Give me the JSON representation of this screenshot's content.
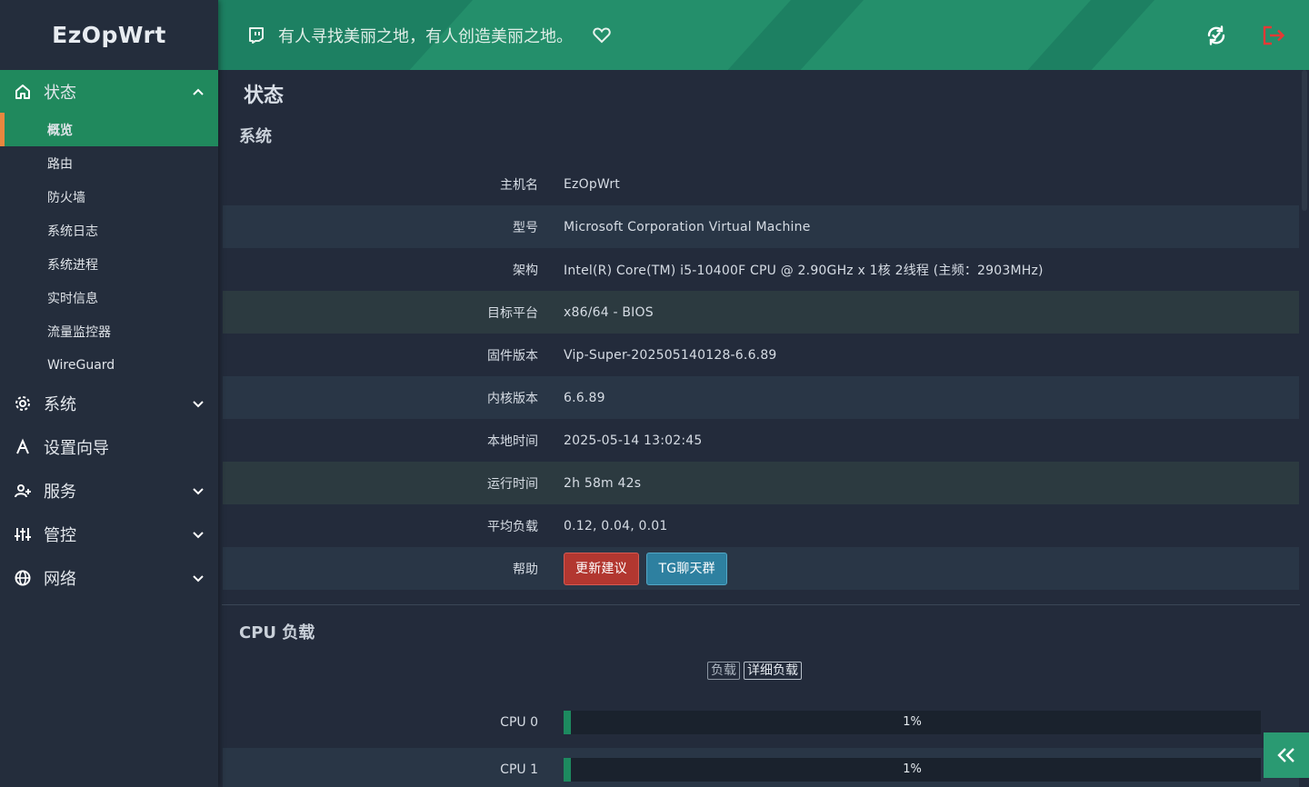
{
  "brand": "EzOpWrt",
  "header": {
    "motto": "有人寻找美丽之地，有人创造美丽之地。",
    "icons": [
      "twitch-icon",
      "heart-icon",
      "refresh-icon",
      "logout-icon"
    ]
  },
  "sidebar": {
    "status": {
      "label": "状态",
      "items": [
        "概览",
        "路由",
        "防火墙",
        "系统日志",
        "系统进程",
        "实时信息",
        "流量监控器",
        "WireGuard"
      ]
    },
    "groups": [
      {
        "label": "系统",
        "icon": "gear-icon"
      },
      {
        "label": "设置向导",
        "icon": "wizard-icon"
      },
      {
        "label": "服务",
        "icon": "user-plus-icon"
      },
      {
        "label": "管控",
        "icon": "sliders-icon"
      },
      {
        "label": "网络",
        "icon": "globe-icon"
      }
    ]
  },
  "main": {
    "page_title": "状态",
    "system_title": "系统",
    "rows": [
      {
        "k": "主机名",
        "v": "EzOpWrt"
      },
      {
        "k": "型号",
        "v": "Microsoft Corporation Virtual Machine"
      },
      {
        "k": "架构",
        "v": "Intel(R) Core(TM) i5-10400F CPU @ 2.90GHz x 1核 2线程 (主频：2903MHz)"
      },
      {
        "k": "目标平台",
        "v": "x86/64 - BIOS"
      },
      {
        "k": "固件版本",
        "v": "Vip-Super-202505140128-6.6.89"
      },
      {
        "k": "内核版本",
        "v": "6.6.89"
      },
      {
        "k": "本地时间",
        "v": "2025-05-14 13:02:45"
      },
      {
        "k": "运行时间",
        "v": "2h 58m 42s"
      },
      {
        "k": "平均负载",
        "v": "0.12, 0.04, 0.01"
      }
    ],
    "help_label": "帮助",
    "btn_update": "更新建议",
    "btn_tg": "TG聊天群",
    "cpu_title": "CPU 负载",
    "load_tabs": [
      "负载",
      "详细负载"
    ],
    "cpus": [
      {
        "name": "CPU 0",
        "pct_text": "1%",
        "fraction": 0.01
      },
      {
        "name": "CPU 1",
        "pct_text": "1%",
        "fraction": 0.01
      }
    ]
  },
  "colors": {
    "accent": "#20895d",
    "marker": "#e8873f",
    "logout": "#e53935"
  }
}
